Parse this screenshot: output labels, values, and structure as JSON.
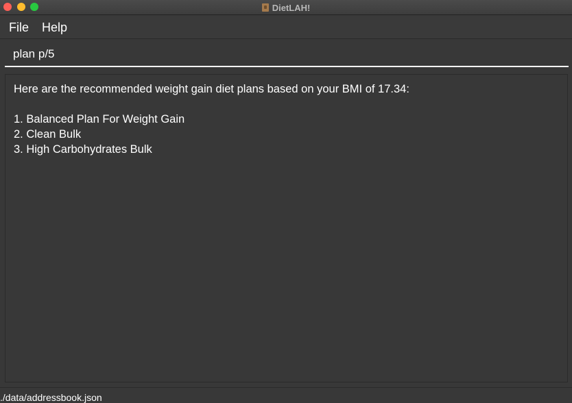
{
  "window": {
    "title": "DietLAH!"
  },
  "menu": {
    "file_label": "File",
    "help_label": "Help"
  },
  "command": {
    "value": "plan p/5"
  },
  "result": {
    "lines": [
      "Here are the recommended weight gain diet plans based on your BMI of 17.34:",
      "",
      "1. Balanced Plan For Weight Gain",
      "2. Clean Bulk",
      "3. High Carbohydrates Bulk"
    ]
  },
  "status": {
    "file_path": "./data/addressbook.json"
  }
}
